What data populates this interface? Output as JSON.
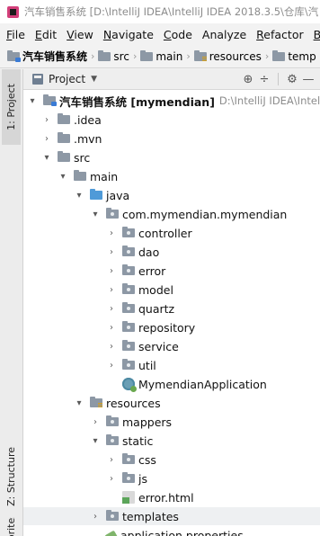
{
  "titlebar": {
    "title": "汽车销售系统 [D:\\IntelliJ IDEA\\IntelliJ IDEA 2018.3.5\\仓库\\汽"
  },
  "menubar": {
    "items": [
      {
        "mnemonic": "F",
        "rest": "ile"
      },
      {
        "mnemonic": "E",
        "rest": "dit"
      },
      {
        "mnemonic": "V",
        "rest": "iew"
      },
      {
        "mnemonic": "N",
        "rest": "avigate"
      },
      {
        "mnemonic": "C",
        "rest": "ode"
      },
      {
        "mnemonic": "",
        "rest": "Analyze"
      },
      {
        "mnemonic": "R",
        "rest": "efactor"
      },
      {
        "mnemonic": "B",
        "rest": "u"
      }
    ]
  },
  "navbar": {
    "crumbs": [
      "汽车销售系统",
      "src",
      "main",
      "resources",
      "temp"
    ]
  },
  "sidebar": {
    "tabs": [
      "1: Project",
      "Z: Structure",
      "orites"
    ]
  },
  "panel": {
    "title": "Project",
    "tools": [
      "⊕",
      "÷",
      "⚙",
      "—"
    ]
  },
  "tree": [
    {
      "label": "汽车销售系统 [mymendian]",
      "path": "D:\\IntelliJ IDEA\\IntelliJ",
      "arrow": "▾",
      "icon": "module"
    },
    {
      "label": ".idea",
      "arrow": "›",
      "icon": "folder"
    },
    {
      "label": ".mvn",
      "arrow": "›",
      "icon": "folder"
    },
    {
      "label": "src",
      "arrow": "▾",
      "icon": "folder"
    },
    {
      "label": "main",
      "arrow": "▾",
      "icon": "folder"
    },
    {
      "label": "java",
      "arrow": "▾",
      "icon": "folder-blue"
    },
    {
      "label": "com.mymendian.mymendian",
      "arrow": "▾",
      "icon": "package"
    },
    {
      "label": "controller",
      "arrow": "›",
      "icon": "package"
    },
    {
      "label": "dao",
      "arrow": "›",
      "icon": "package"
    },
    {
      "label": "error",
      "arrow": "›",
      "icon": "package"
    },
    {
      "label": "model",
      "arrow": "›",
      "icon": "package"
    },
    {
      "label": "quartz",
      "arrow": "›",
      "icon": "package"
    },
    {
      "label": "repository",
      "arrow": "›",
      "icon": "package"
    },
    {
      "label": "service",
      "arrow": "›",
      "icon": "package"
    },
    {
      "label": "util",
      "arrow": "›",
      "icon": "package"
    },
    {
      "label": "MymendianApplication",
      "arrow": "",
      "icon": "spring-class"
    },
    {
      "label": "resources",
      "arrow": "▾",
      "icon": "resources-folder"
    },
    {
      "label": "mappers",
      "arrow": "›",
      "icon": "folder"
    },
    {
      "label": "static",
      "arrow": "▾",
      "icon": "folder"
    },
    {
      "label": "css",
      "arrow": "›",
      "icon": "folder"
    },
    {
      "label": "js",
      "arrow": "›",
      "icon": "folder"
    },
    {
      "label": "error.html",
      "arrow": "",
      "icon": "html-file"
    },
    {
      "label": "templates",
      "arrow": "›",
      "icon": "folder"
    },
    {
      "label": "application.properties",
      "arrow": "",
      "icon": "properties-file"
    }
  ]
}
